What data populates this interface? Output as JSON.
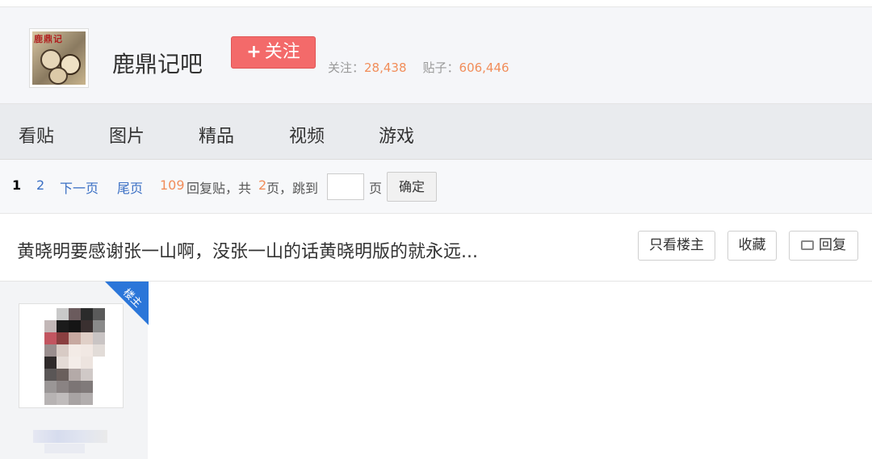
{
  "header": {
    "forum_name": "鹿鼎记吧",
    "logo_text": "鹿鼎记",
    "follow_plus": "+",
    "follow_label": "关注",
    "followers_label": "关注：",
    "followers_count": "28,438",
    "posts_label": "贴子：",
    "posts_count": "606,446"
  },
  "nav": {
    "items": [
      "看贴",
      "图片",
      "精品",
      "视频",
      "游戏"
    ]
  },
  "pager": {
    "current_page": "1",
    "page_2": "2",
    "next_page": "下一页",
    "last_page": "尾页",
    "reply_count": "109",
    "reply_text": "回复贴，共",
    "total_pages": "2",
    "pages_text": "页，跳到",
    "page_unit": "页",
    "confirm": "确定"
  },
  "thread": {
    "title": "黄晓明要感谢张一山啊，没张一山的话黄晓明版的就永远...",
    "only_op": "只看楼主",
    "favorite": "收藏",
    "reply": "回复"
  },
  "post": {
    "op_badge": "楼主"
  },
  "colors": {
    "follow_button": "#f36a6a",
    "stat_number": "#f18d5a",
    "link": "#3a6fc4",
    "op_badge": "#2b76d9"
  }
}
